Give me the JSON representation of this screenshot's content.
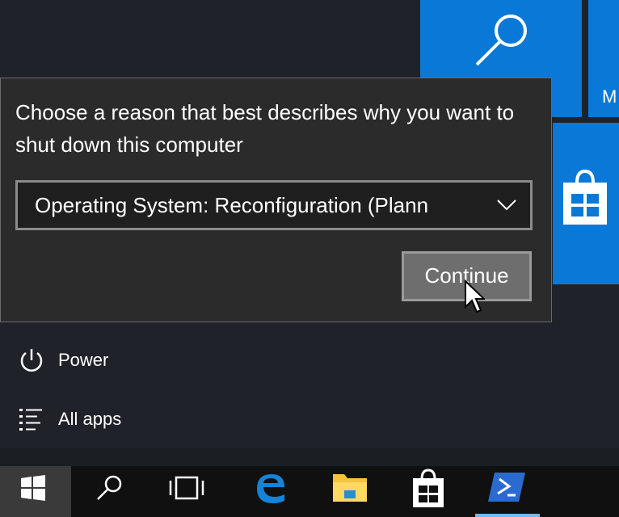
{
  "tiles": {
    "partial_label": "M"
  },
  "dialog": {
    "prompt": "Choose a reason that best describes why you want to shut down this computer",
    "reason_value": "Operating System: Reconfiguration (Plann",
    "continue_label": "Continue"
  },
  "menu": {
    "power_label": "Power",
    "all_apps_label": "All apps"
  },
  "taskbar": {
    "items": [
      "start-icon",
      "search-icon",
      "task-view-icon",
      "edge-icon",
      "file-explorer-icon",
      "store-icon",
      "powershell-icon"
    ]
  },
  "colors": {
    "accent": "#0a78d7",
    "dialog_bg": "#2b2b2b",
    "taskbar_bg": "#101010"
  }
}
